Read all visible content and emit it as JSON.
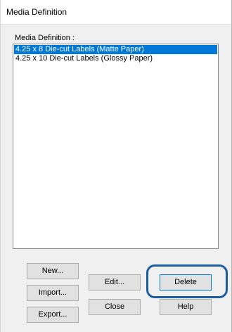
{
  "window": {
    "title": "Media Definition"
  },
  "media_group": {
    "label": "Media Definition :",
    "items": [
      {
        "label": "4.25 x 8 Die-cut Labels (Matte Paper)",
        "selected": true
      },
      {
        "label": "4.25 x 10 Die-cut Labels (Glossy Paper)",
        "selected": false
      }
    ]
  },
  "buttons": {
    "new": "New...",
    "import": "Import...",
    "export": "Export...",
    "edit": "Edit...",
    "close": "Close",
    "delete": "Delete",
    "help": "Help"
  },
  "colors": {
    "selection": "#0078d7",
    "highlight_ring": "#1b5d9e"
  }
}
